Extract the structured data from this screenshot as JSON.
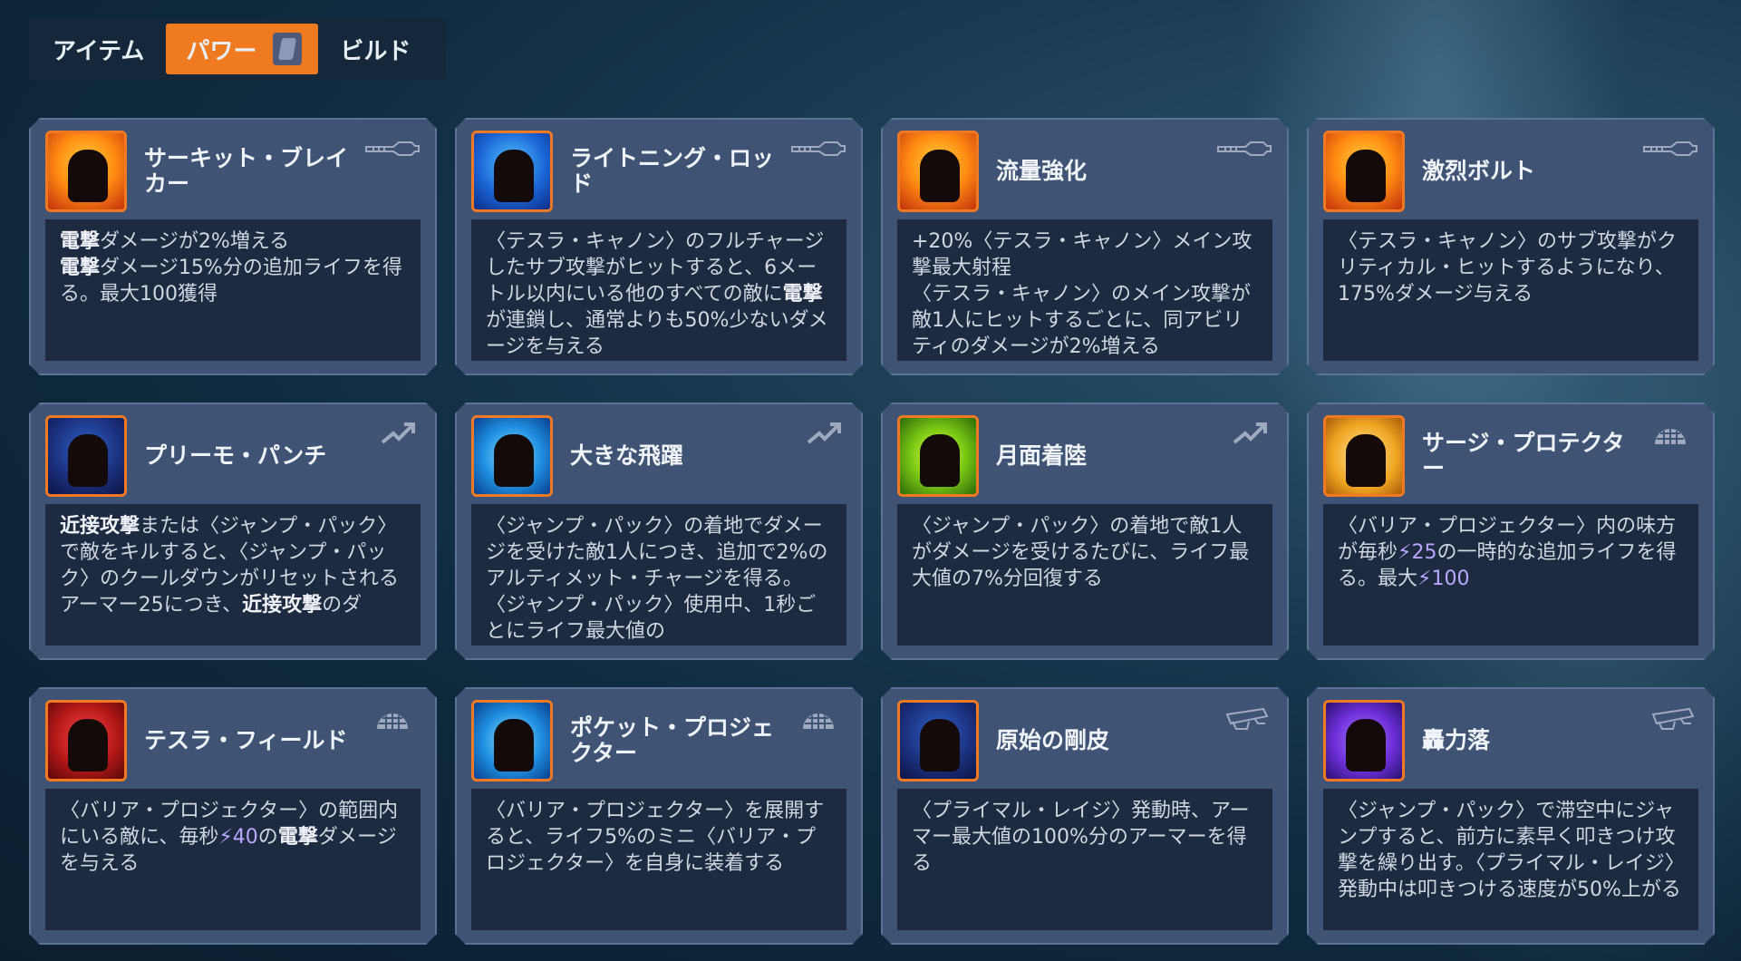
{
  "tabs": [
    {
      "label": "アイテム",
      "active": false
    },
    {
      "label": "パワー",
      "active": true
    },
    {
      "label": "ビルド",
      "active": false
    }
  ],
  "accent": "#ef7a1f",
  "cards": [
    {
      "name": "サーキット・ブレイカー",
      "icon": "circuit-breaker-icon",
      "type": "tesla-cannon-icon",
      "iconColor": "ico-orange",
      "desc": [
        [
          {
            "t": "電撃",
            "b": true
          },
          {
            "t": "ダメージが2%増える"
          }
        ],
        [
          {
            "t": "電撃",
            "b": true
          },
          {
            "t": "ダメージ15%分の追加ライフを得る。最大100獲得"
          }
        ]
      ]
    },
    {
      "name": "ライトニング・ロッド",
      "icon": "lightning-rod-icon",
      "type": "tesla-cannon-icon",
      "iconColor": "ico-blue",
      "desc": [
        [
          {
            "t": "〈テスラ・キャノン〉のフルチャージしたサブ攻撃がヒットすると、6メートル以内にいる他のすべての敵に"
          },
          {
            "t": "電撃",
            "b": true
          },
          {
            "t": "が連鎖し、通常よりも50%少ないダメージを与える"
          }
        ]
      ]
    },
    {
      "name": "流量強化",
      "icon": "flux-boost-icon",
      "type": "tesla-cannon-icon",
      "iconColor": "ico-orange",
      "desc": [
        [
          {
            "t": "+20%〈テスラ・キャノン〉メイン攻撃最大射程"
          }
        ],
        [
          {
            "t": "〈テスラ・キャノン〉のメイン攻撃が敵1人にヒットするごとに、同アビリティのダメージが2%増える"
          }
        ]
      ]
    },
    {
      "name": "激烈ボルト",
      "icon": "fierce-bolt-icon",
      "type": "tesla-cannon-icon",
      "iconColor": "ico-orange",
      "desc": [
        [
          {
            "t": "〈テスラ・キャノン〉のサブ攻撃がクリティカル・ヒットするようになり、175%ダメージ与える"
          }
        ]
      ]
    },
    {
      "name": "プリーモ・パンチ",
      "icon": "primo-punch-icon",
      "type": "jump-pack-icon",
      "iconColor": "ico-navy",
      "desc": [
        [
          {
            "t": "近接攻撃",
            "b": true
          },
          {
            "t": "または〈ジャンプ・パック〉で敵をキルすると、〈ジャンプ・パック〉のクールダウンがリセットされる"
          }
        ],
        [
          {
            "t": "アーマー25につき、"
          },
          {
            "t": "近接攻撃",
            "b": true
          },
          {
            "t": "のダ"
          }
        ]
      ]
    },
    {
      "name": "大きな飛躍",
      "icon": "big-leap-icon",
      "type": "jump-pack-icon",
      "iconColor": "ico-cyan",
      "desc": [
        [
          {
            "t": "〈ジャンプ・パック〉の着地でダメージを受けた敵1人につき、追加で2%のアルティメット・チャージを得る。〈ジャンプ・パック〉使用中、1秒ごとにライフ最大値の"
          }
        ]
      ]
    },
    {
      "name": "月面着陸",
      "icon": "moon-landing-icon",
      "type": "jump-pack-icon",
      "iconColor": "ico-green",
      "desc": [
        [
          {
            "t": "〈ジャンプ・パック〉の着地で敵1人がダメージを受けるたびに、ライフ最大値の7%分回復する"
          }
        ]
      ]
    },
    {
      "name": "サージ・プロテクター",
      "icon": "surge-protector-icon",
      "type": "barrier-projector-icon",
      "iconColor": "ico-gold",
      "desc": [
        [
          {
            "t": "〈バリア・プロジェクター〉内の味方が毎秒"
          },
          {
            "t": "⚡25",
            "h": true
          },
          {
            "t": "の一時的な追加ライフを得る。最大"
          },
          {
            "t": "⚡100",
            "h": true
          }
        ]
      ]
    },
    {
      "name": "テスラ・フィールド",
      "icon": "tesla-field-icon",
      "type": "barrier-projector-icon",
      "iconColor": "ico-red",
      "desc": [
        [
          {
            "t": "〈バリア・プロジェクター〉の範囲内にいる敵に、毎秒"
          },
          {
            "t": "⚡40",
            "h": true
          },
          {
            "t": "の"
          },
          {
            "t": "電撃",
            "b": true
          },
          {
            "t": "ダメージを与える"
          }
        ]
      ]
    },
    {
      "name": "ポケット・プロジェクター",
      "icon": "pocket-projector-icon",
      "type": "barrier-projector-icon",
      "iconColor": "ico-cyan",
      "desc": [
        [
          {
            "t": "〈バリア・プロジェクター〉を展開すると、ライフ5%のミニ〈バリア・プロジェクター〉を自身に装着する"
          }
        ]
      ]
    },
    {
      "name": "原始の剛皮",
      "icon": "primal-hide-icon",
      "type": "primal-rage-icon",
      "iconColor": "ico-navy",
      "desc": [
        [
          {
            "t": "〈プライマル・レイジ〉発動時、アーマー最大値の100%分のアーマーを得る"
          }
        ]
      ]
    },
    {
      "name": "轟力落",
      "icon": "thunder-drop-icon",
      "type": "primal-rage-icon",
      "iconColor": "ico-purple",
      "desc": [
        [
          {
            "t": "〈ジャンプ・パック〉で滞空中にジャンプすると、前方に素早く叩きつけ攻撃を繰り出す。〈プライマル・レイジ〉発動中は叩きつける速度が50%上がる"
          }
        ]
      ]
    }
  ]
}
